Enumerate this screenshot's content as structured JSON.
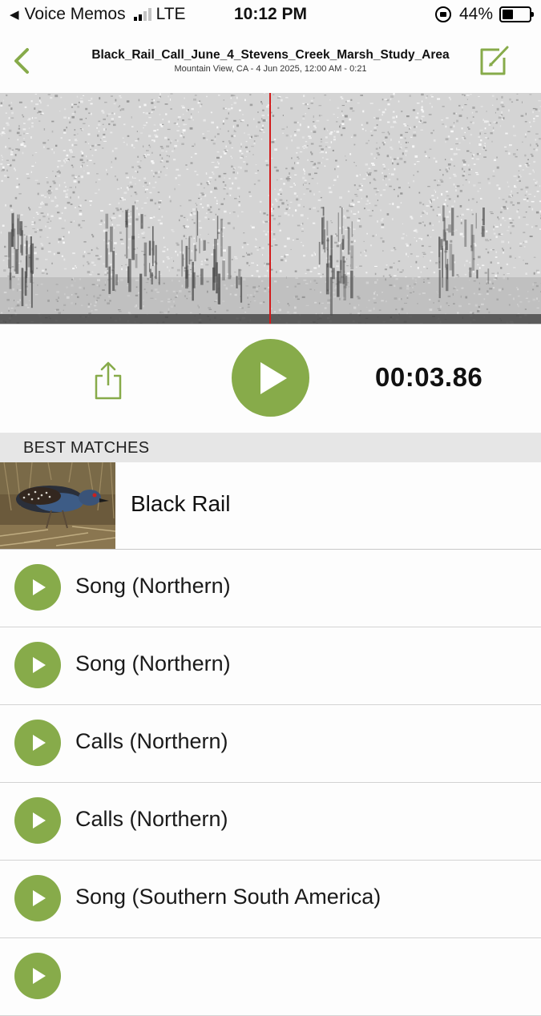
{
  "status_bar": {
    "back_app": "Voice Memos",
    "carrier": "LTE",
    "time": "10:12 PM",
    "battery": "44%",
    "battery_level": 0.44
  },
  "header": {
    "title": "Black_Rail_Call_June_4_Stevens_Creek_Marsh_Study_Area",
    "subtitle": "Mountain View, CA - 4 Jun 2025, 12:00 AM - 0:21",
    "back_icon": "chevron-left-icon",
    "edit_icon": "edit-icon"
  },
  "player": {
    "elapsed": "00:03.86",
    "share_icon": "share-icon",
    "play_icon": "play-icon"
  },
  "matches": {
    "heading": "BEST MATCHES",
    "bird": "Black Rail",
    "sounds": [
      "Song (Northern)",
      "Song (Northern)",
      "Calls (Northern)",
      "Calls (Northern)",
      "Song (Southern South America)"
    ]
  },
  "colors": {
    "accent": "#87ab4a",
    "cursor": "#d21b1b",
    "section_bg": "#e6e6e6"
  }
}
